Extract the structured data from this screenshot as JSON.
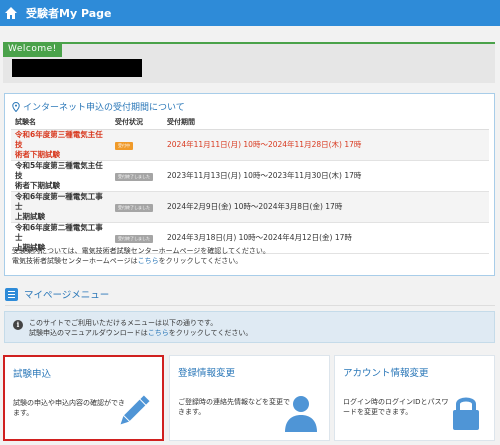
{
  "header": {
    "title": "受験者My Page"
  },
  "welcome": {
    "tag": "Welcome!"
  },
  "schedule": {
    "title": "インターネット申込の受付期間について",
    "columns": [
      "試験名",
      "受付状況",
      "受付期間"
    ],
    "rows": [
      {
        "name_l1": "令和6年度第三種電気主任技",
        "name_l2": "術者下期試験",
        "status": "受付中",
        "status_type": "open",
        "period": "2024年11月11日(月) 10時～2024年11月28日(木) 17時",
        "highlight": true
      },
      {
        "name_l1": "令和5年度第三種電気主任技",
        "name_l2": "術者下期試験",
        "status": "受付終了しました",
        "status_type": "closed",
        "period": "2023年11月13日(月) 10時～2023年11月30日(木) 17時",
        "highlight": false
      },
      {
        "name_l1": "令和6年度第一種電気工事士",
        "name_l2": "上期試験",
        "status": "受付終了しました",
        "status_type": "closed",
        "period": "2024年2月9日(金) 10時～2024年3月8日(金) 17時",
        "highlight": false
      },
      {
        "name_l1": "令和6年度第二種電気工事士",
        "name_l2": "上期試験",
        "status": "受付終了しました",
        "status_type": "closed",
        "period": "2024年3月18日(月) 10時～2024年4月12日(金) 17時",
        "highlight": false
      }
    ],
    "note_l1": "受験案内については、電気技術者試験センターホームページを確認してください。",
    "note_l2_pre": "電気技術者試験センターホームページは",
    "note_l2_link": "こちら",
    "note_l2_post": "をクリックしてください。"
  },
  "mypage_menu": {
    "title": "マイページメニュー",
    "info_l1": "このサイトでご利用いただけるメニューは以下の通りです。",
    "info_l2_pre": "試験申込のマニュアルダウンロードは",
    "info_l2_link": "こちら",
    "info_l2_post": "をクリックしてください。",
    "cards": [
      {
        "title": "試験申込",
        "desc": "試験の申込や申込内容の確認ができます。",
        "icon": "pencil-icon"
      },
      {
        "title": "登録情報変更",
        "desc": "ご登録時の連絡先情報などを変更できます。",
        "icon": "user-icon"
      },
      {
        "title": "アカウント情報変更",
        "desc": "ログイン時のログインIDとパスワードを変更できます。",
        "icon": "lock-icon"
      }
    ]
  },
  "colors": {
    "header": "#2e8bd8",
    "welcome": "#4aa24a",
    "accent_red": "#d8391f",
    "link": "#2a77b8",
    "selected_border": "#d0201f"
  }
}
